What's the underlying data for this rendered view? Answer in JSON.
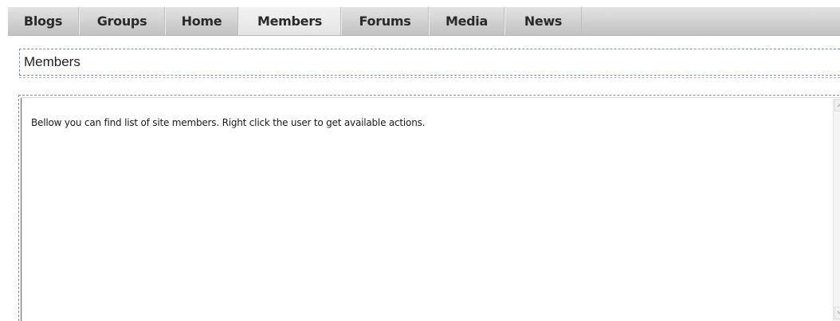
{
  "nav": {
    "tabs": [
      {
        "label": "Blogs",
        "active": false
      },
      {
        "label": "Groups",
        "active": false
      },
      {
        "label": "Home",
        "active": false
      },
      {
        "label": "Members",
        "active": true
      },
      {
        "label": "Forums",
        "active": false
      },
      {
        "label": "Media",
        "active": false
      },
      {
        "label": "News",
        "active": false
      }
    ]
  },
  "page": {
    "title": "Members",
    "description": "Bellow you can find list of site members. Right click the user to get available actions."
  },
  "scrollbar": {
    "up_icon": "chevron-up-icon",
    "down_icon": "chevron-down-icon"
  }
}
